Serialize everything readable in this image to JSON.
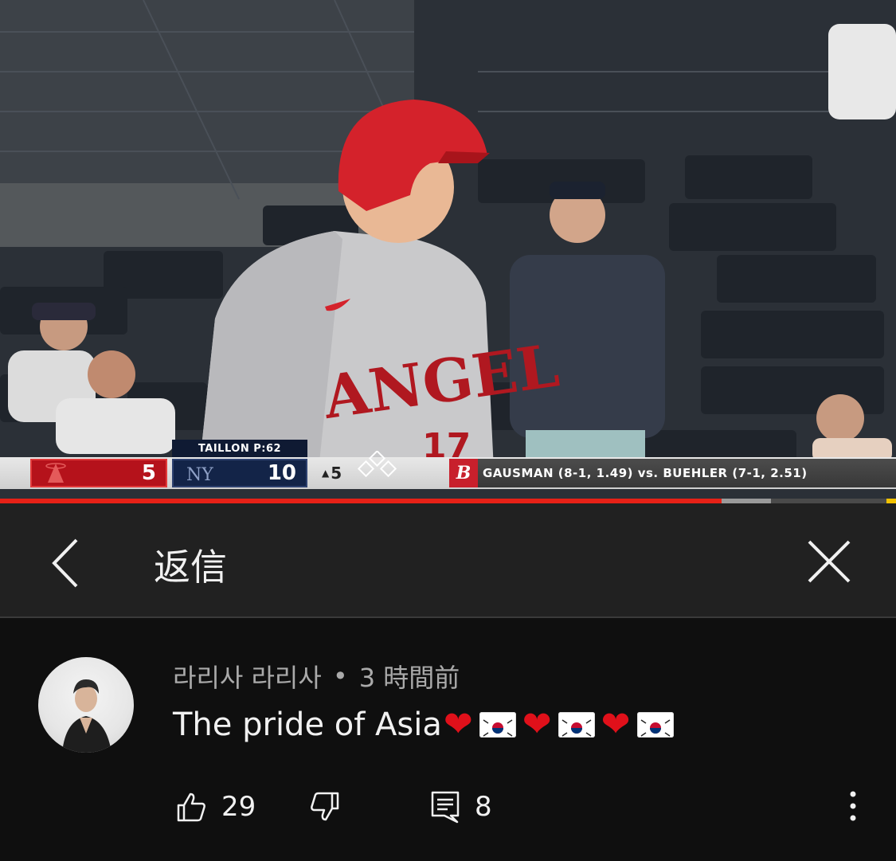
{
  "video": {
    "scorebug": {
      "pitcher_tag": "TAILLON P:62",
      "away_score": "5",
      "home_score": "10",
      "inning": "5",
      "matchup": "GAUSMAN (8-1, 1.49) vs. BUEHLER (7-1, 2.51)",
      "away_color": "#b5121b",
      "home_color": "#132448"
    },
    "progress": {
      "played_fraction": 0.805,
      "buffered_fraction": 0.86
    }
  },
  "header": {
    "title": "返信",
    "back_icon": "chevron-left-icon",
    "close_icon": "close-icon"
  },
  "comment": {
    "author": "라리사 라리사",
    "separator": "•",
    "time": "3 時間前",
    "text_prefix": "The pride of Asia",
    "likes": "29",
    "replies": "8"
  },
  "colors": {
    "accent": "#e62117",
    "background": "#0f0f0f",
    "header_bg": "#212121"
  }
}
